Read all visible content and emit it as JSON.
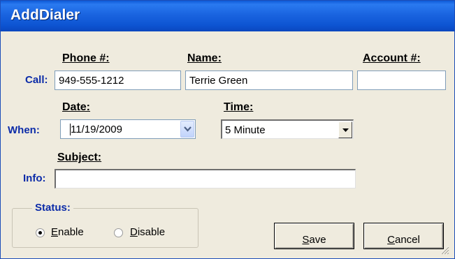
{
  "window": {
    "title": "AddDialer"
  },
  "headers": {
    "phone": "Phone #:",
    "name": "Name:",
    "account": "Account #:",
    "date": "Date:",
    "time": "Time:",
    "subject": "Subject:"
  },
  "side_labels": {
    "call": "Call:",
    "when": "When:",
    "info": "Info:"
  },
  "fields": {
    "phone": "949-555-1212",
    "name": "Terrie Green",
    "account": "",
    "date": "11/19/2009",
    "time": "5 Minute",
    "subject": ""
  },
  "status": {
    "title": "Status:",
    "enable_prefix": "",
    "enable_mnemonic": "E",
    "enable_rest": "nable",
    "disable_mnemonic": "D",
    "disable_rest": "isable",
    "selected": "Enable"
  },
  "buttons": {
    "save_mnemonic": "S",
    "save_rest": "ave",
    "cancel_mnemonic": "C",
    "cancel_rest": "ancel"
  },
  "icons": [
    "chevron-down-icon",
    "dropdown-arrow-icon",
    "resize-grip-icon"
  ]
}
